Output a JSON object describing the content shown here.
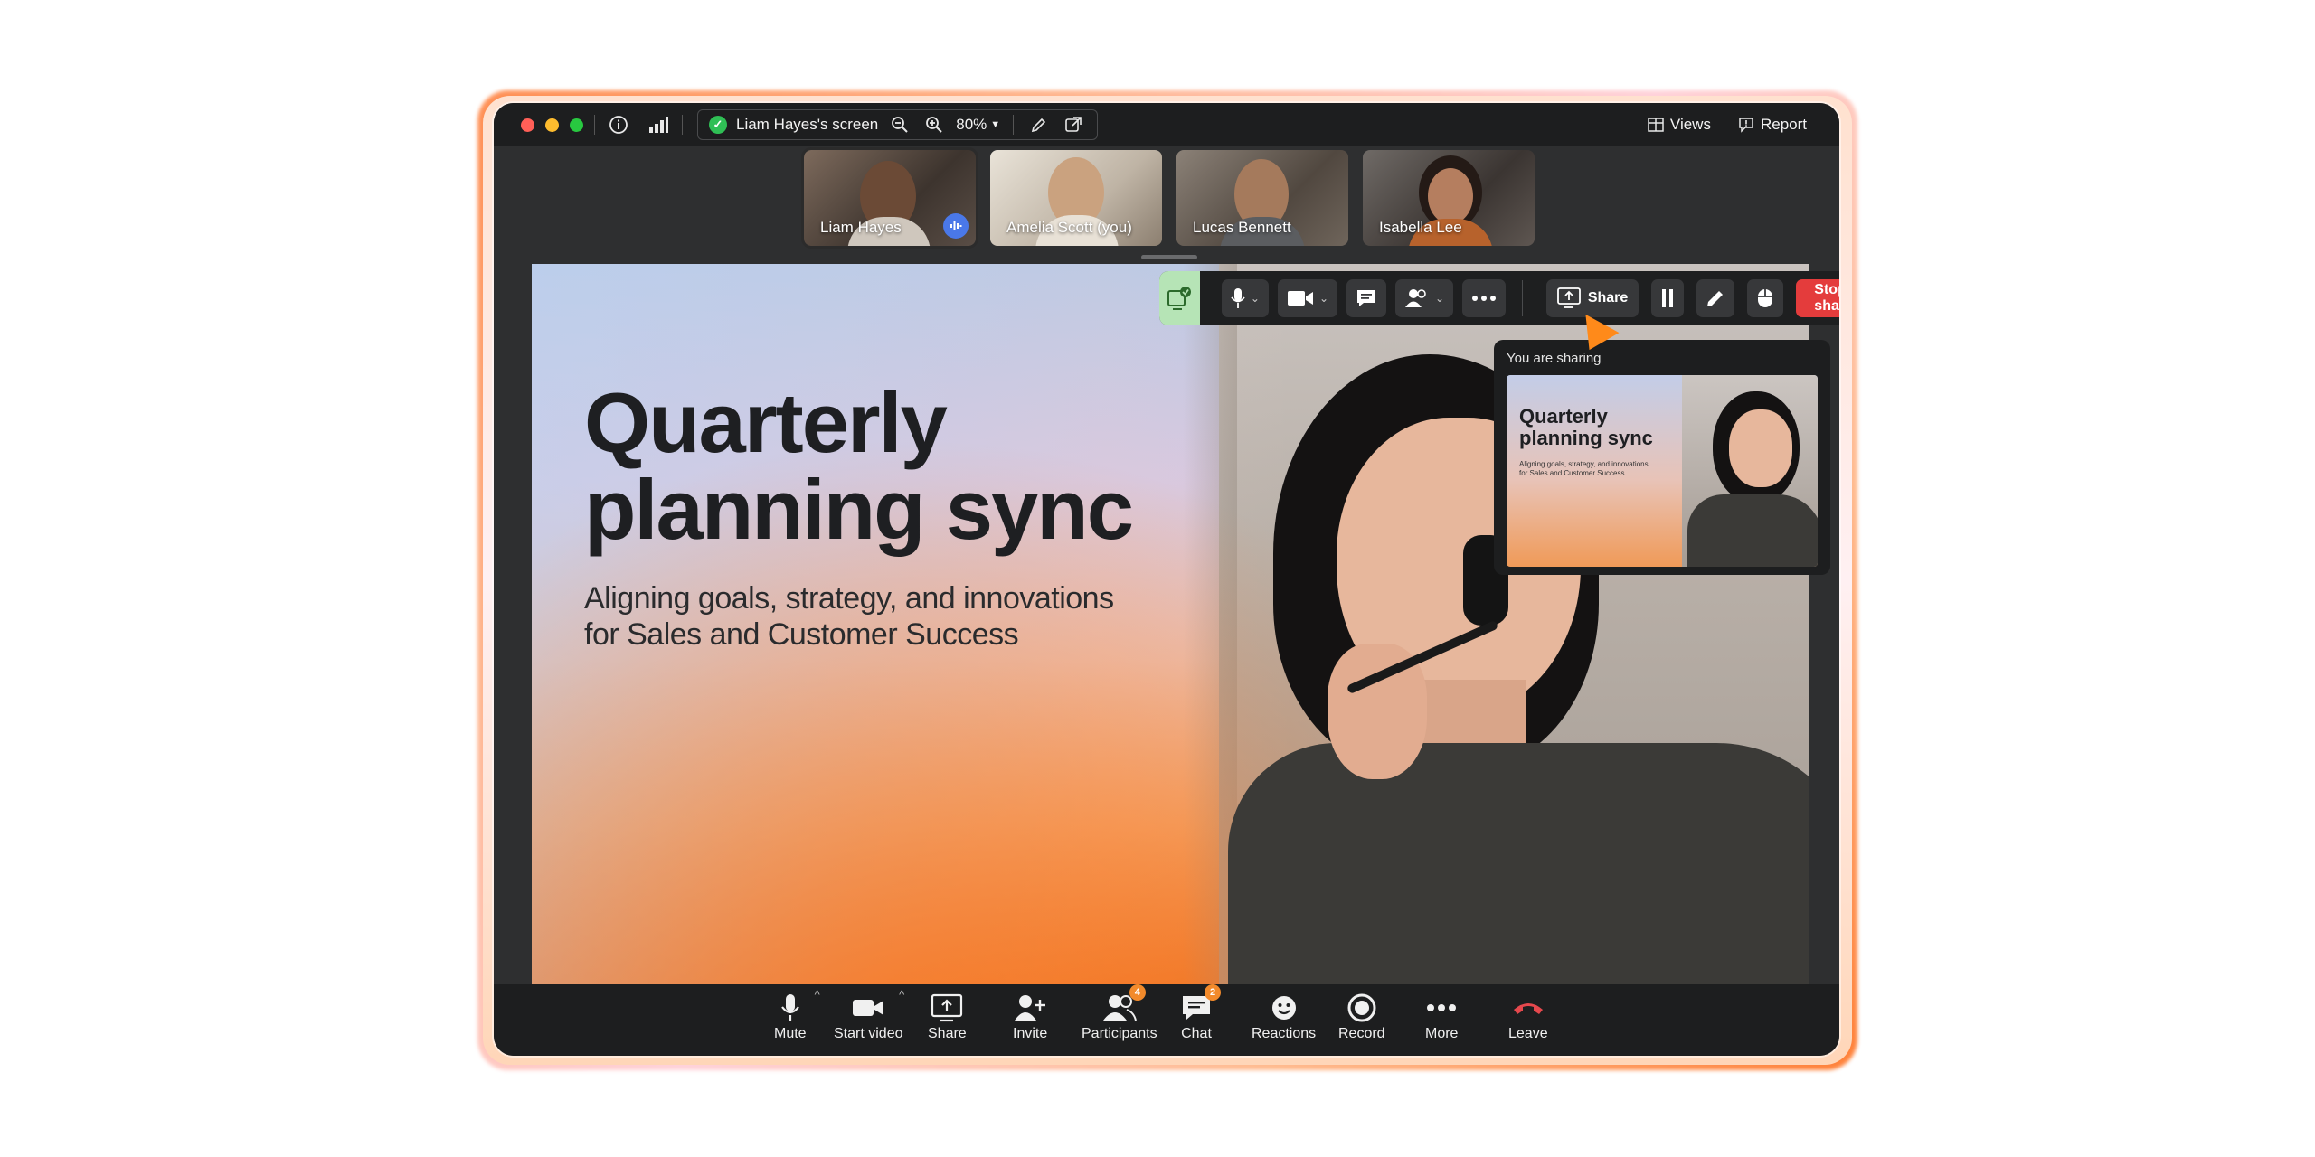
{
  "window": {
    "traffic_lights": [
      "#ff5f57",
      "#febc2e",
      "#28c840"
    ]
  },
  "topbar": {
    "screen_label": "Liam Hayes's screen",
    "zoom_level": "80%",
    "views_label": "Views",
    "report_label": "Report"
  },
  "participants": [
    {
      "name": "Liam Hayes",
      "speaking": true
    },
    {
      "name": "Amelia Scott (you)",
      "speaking": false
    },
    {
      "name": "Lucas Bennett",
      "speaking": false
    },
    {
      "name": "Isabella Lee",
      "speaking": false
    }
  ],
  "slide": {
    "title_line1": "Quarterly",
    "title_line2": "planning sync",
    "subtitle_line1": "Aligning goals, strategy, and innovations",
    "subtitle_line2": "for Sales and Customer Success"
  },
  "share_toolbar": {
    "share_label": "Share",
    "stop_label": "Stop sharing"
  },
  "preview": {
    "label": "You are sharing",
    "title_line1": "Quarterly",
    "title_line2": "planning sync",
    "subtitle_line1": "Aligning goals, strategy, and innovations",
    "subtitle_line2": "for Sales and Customer Success"
  },
  "bottombar": {
    "mute": "Mute",
    "start_video": "Start video",
    "share": "Share",
    "invite": "Invite",
    "participants": "Participants",
    "participants_badge": "4",
    "chat": "Chat",
    "chat_badge": "2",
    "reactions": "Reactions",
    "record": "Record",
    "more": "More",
    "leave": "Leave"
  },
  "colors": {
    "accent_orange": "#f28a2b",
    "stop_red": "#e43c3c",
    "leave_red": "#e5484d",
    "speaking_blue": "#4a78e8"
  }
}
